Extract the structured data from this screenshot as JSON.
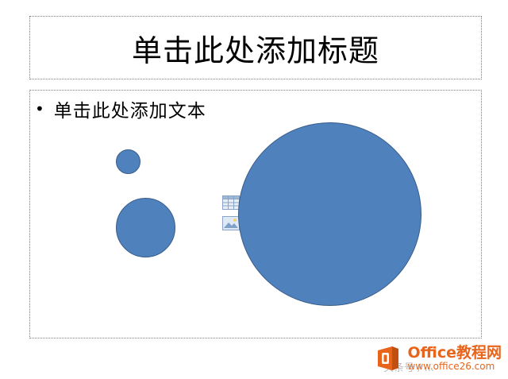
{
  "slide": {
    "title_placeholder": "单击此处添加标题",
    "content_placeholder": "单击此处添加文本",
    "bullet_char": "•"
  },
  "shapes": {
    "fill_color": "#4f81bd",
    "stroke_color": "#385d8a",
    "items": [
      "small-circle",
      "medium-circle",
      "large-circle"
    ]
  },
  "placeholder_icons": [
    "insert-table-icon",
    "insert-picture-icon"
  ],
  "watermark": {
    "brand": "Office教程网",
    "url": "www.office26.com",
    "faint_text": "头条号 / ...",
    "brand_color": "#e8641b"
  }
}
